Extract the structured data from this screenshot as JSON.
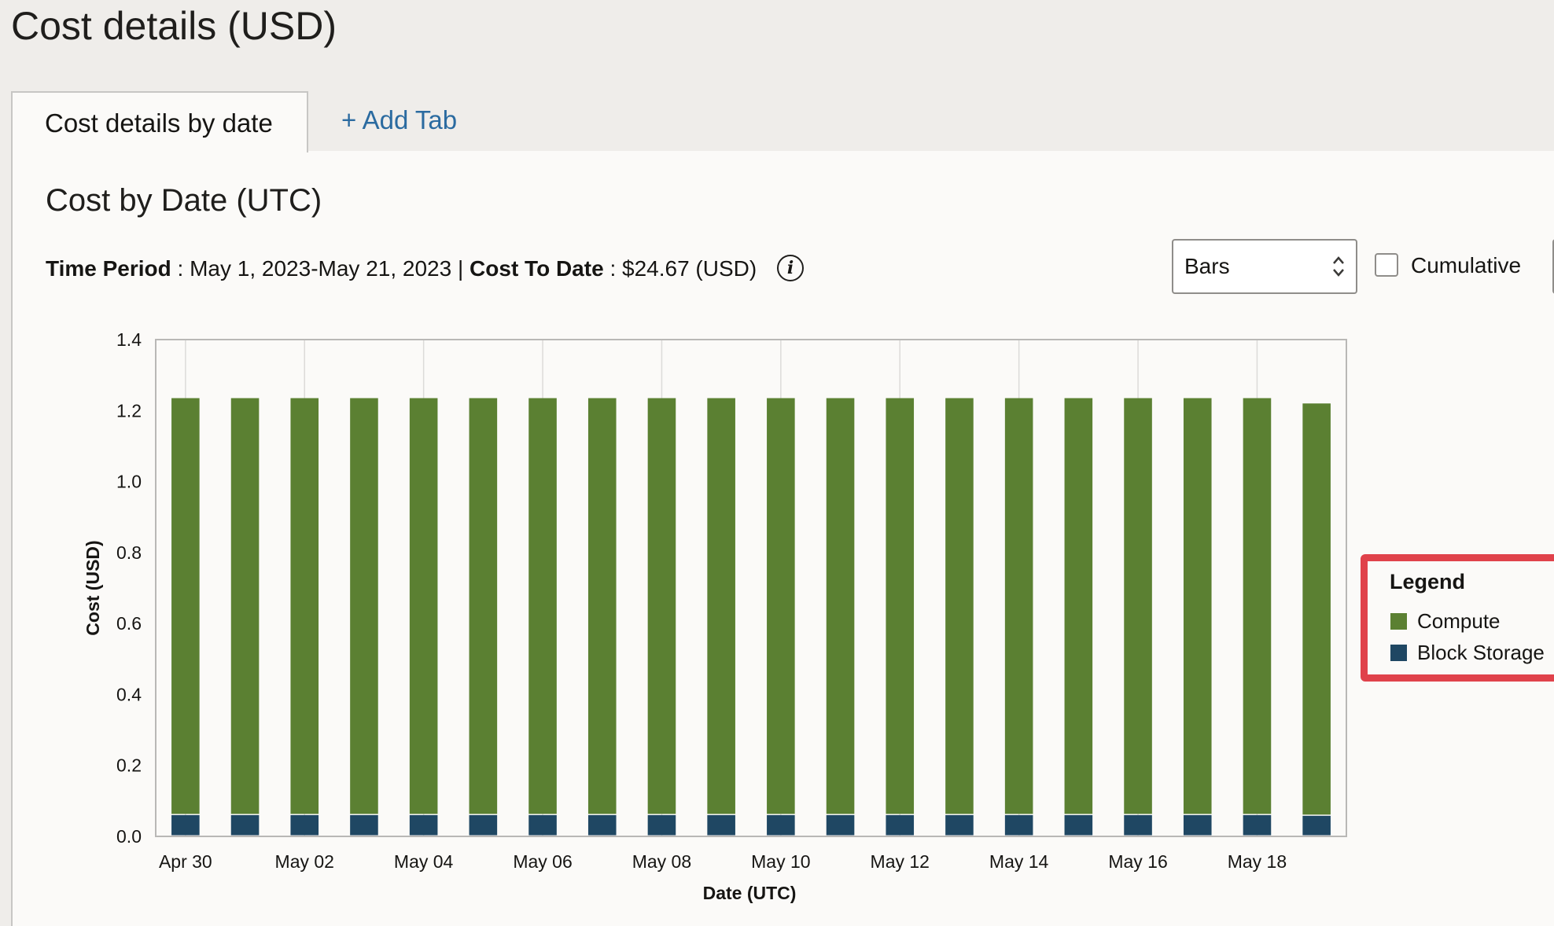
{
  "page": {
    "title": "Cost details (USD)"
  },
  "tabs": [
    {
      "label": "Cost details by date",
      "active": true
    },
    {
      "label": "+ Add Tab",
      "active": false
    }
  ],
  "section": {
    "title": "Cost by Date (UTC)",
    "time_period_label": "Time Period",
    "time_period_value": "May 1, 2023-May 21, 2023",
    "separator": "|",
    "cost_to_date_label": "Cost To Date",
    "cost_to_date_value": "$24.67 (USD)",
    "info_icon": "info-icon"
  },
  "controls": {
    "chart_type_select": {
      "value": "Bars"
    },
    "cumulative_checkbox": {
      "label": "Cumulative",
      "checked": false
    }
  },
  "legend": {
    "title": "Legend",
    "items": [
      {
        "label": "Compute",
        "color": "#5b8032"
      },
      {
        "label": "Block Storage",
        "color": "#1f4763"
      }
    ],
    "highlight_color": "#e0424b"
  },
  "chart_data": {
    "type": "bar",
    "stacked": true,
    "xlabel": "Date (UTC)",
    "ylabel": "Cost (USD)",
    "ylim": [
      0,
      1.4
    ],
    "yticks": [
      "0.0",
      "0.2",
      "0.4",
      "0.6",
      "0.8",
      "1.0",
      "1.2",
      "1.4"
    ],
    "xtick_labels": [
      "Apr 30",
      "May 02",
      "May 04",
      "May 06",
      "May 08",
      "May 10",
      "May 12",
      "May 14",
      "May 16",
      "May 18"
    ],
    "categories": [
      "Apr 30",
      "May 01",
      "May 02",
      "May 03",
      "May 04",
      "May 05",
      "May 06",
      "May 07",
      "May 08",
      "May 09",
      "May 10",
      "May 11",
      "May 12",
      "May 13",
      "May 14",
      "May 15",
      "May 16",
      "May 17",
      "May 18",
      "May 19"
    ],
    "series": [
      {
        "name": "Block Storage",
        "color": "#1f4763",
        "values": [
          0.06,
          0.06,
          0.06,
          0.06,
          0.06,
          0.06,
          0.06,
          0.06,
          0.06,
          0.06,
          0.06,
          0.06,
          0.06,
          0.06,
          0.06,
          0.06,
          0.06,
          0.06,
          0.06,
          0.058
        ]
      },
      {
        "name": "Compute",
        "color": "#5b8032",
        "values": [
          1.175,
          1.175,
          1.175,
          1.175,
          1.175,
          1.175,
          1.175,
          1.175,
          1.175,
          1.175,
          1.175,
          1.175,
          1.175,
          1.175,
          1.175,
          1.175,
          1.175,
          1.175,
          1.175,
          1.162
        ]
      }
    ],
    "grid": {
      "vertical": true,
      "horizontal": false
    },
    "legend_position": "right"
  }
}
